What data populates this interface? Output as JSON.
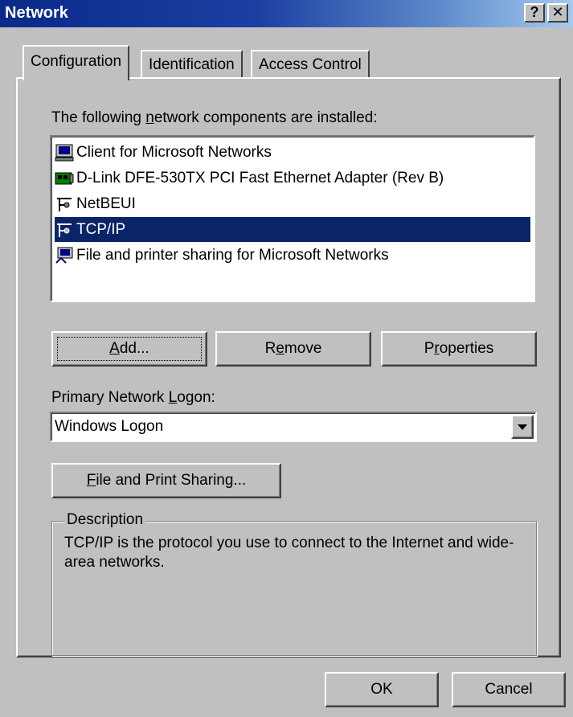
{
  "window": {
    "title": "Network",
    "help_btn": "?",
    "close_btn": "✕"
  },
  "tabs": [
    {
      "label": "Configuration",
      "active": true
    },
    {
      "label": "Identification",
      "active": false
    },
    {
      "label": "Access Control",
      "active": false
    }
  ],
  "components": {
    "label_pre": "The following ",
    "label_mnemonic": "n",
    "label_post": "etwork components are installed:",
    "items": [
      {
        "label": "Client for Microsoft Networks",
        "icon": "client-icon",
        "selected": false
      },
      {
        "label": "D-Link DFE-530TX PCI Fast Ethernet Adapter (Rev B)",
        "icon": "adapter-icon",
        "selected": false
      },
      {
        "label": "NetBEUI",
        "icon": "protocol-icon",
        "selected": false
      },
      {
        "label": "TCP/IP",
        "icon": "protocol-icon",
        "selected": true
      },
      {
        "label": "File and printer sharing for Microsoft Networks",
        "icon": "service-icon",
        "selected": false
      }
    ]
  },
  "buttons": {
    "add_mn": "A",
    "add_rest": "dd...",
    "remove_pre": "R",
    "remove_mn": "e",
    "remove_rest": "move",
    "properties_pre": "P",
    "properties_mn": "r",
    "properties_rest": "operties",
    "file_print_mn": "F",
    "file_print_rest": "ile and Print Sharing...",
    "ok": "OK",
    "cancel": "Cancel"
  },
  "logon": {
    "label_pre": "Primary Network ",
    "label_mnemonic": "L",
    "label_post": "ogon:",
    "selected": "Windows Logon"
  },
  "description": {
    "legend": "Description",
    "text": "TCP/IP is the protocol you use to connect to the Internet and wide-area networks."
  },
  "colors": {
    "selection": "#0a2469",
    "titlebar_start": "#0a2a8a",
    "face": "#c0c0c0"
  }
}
